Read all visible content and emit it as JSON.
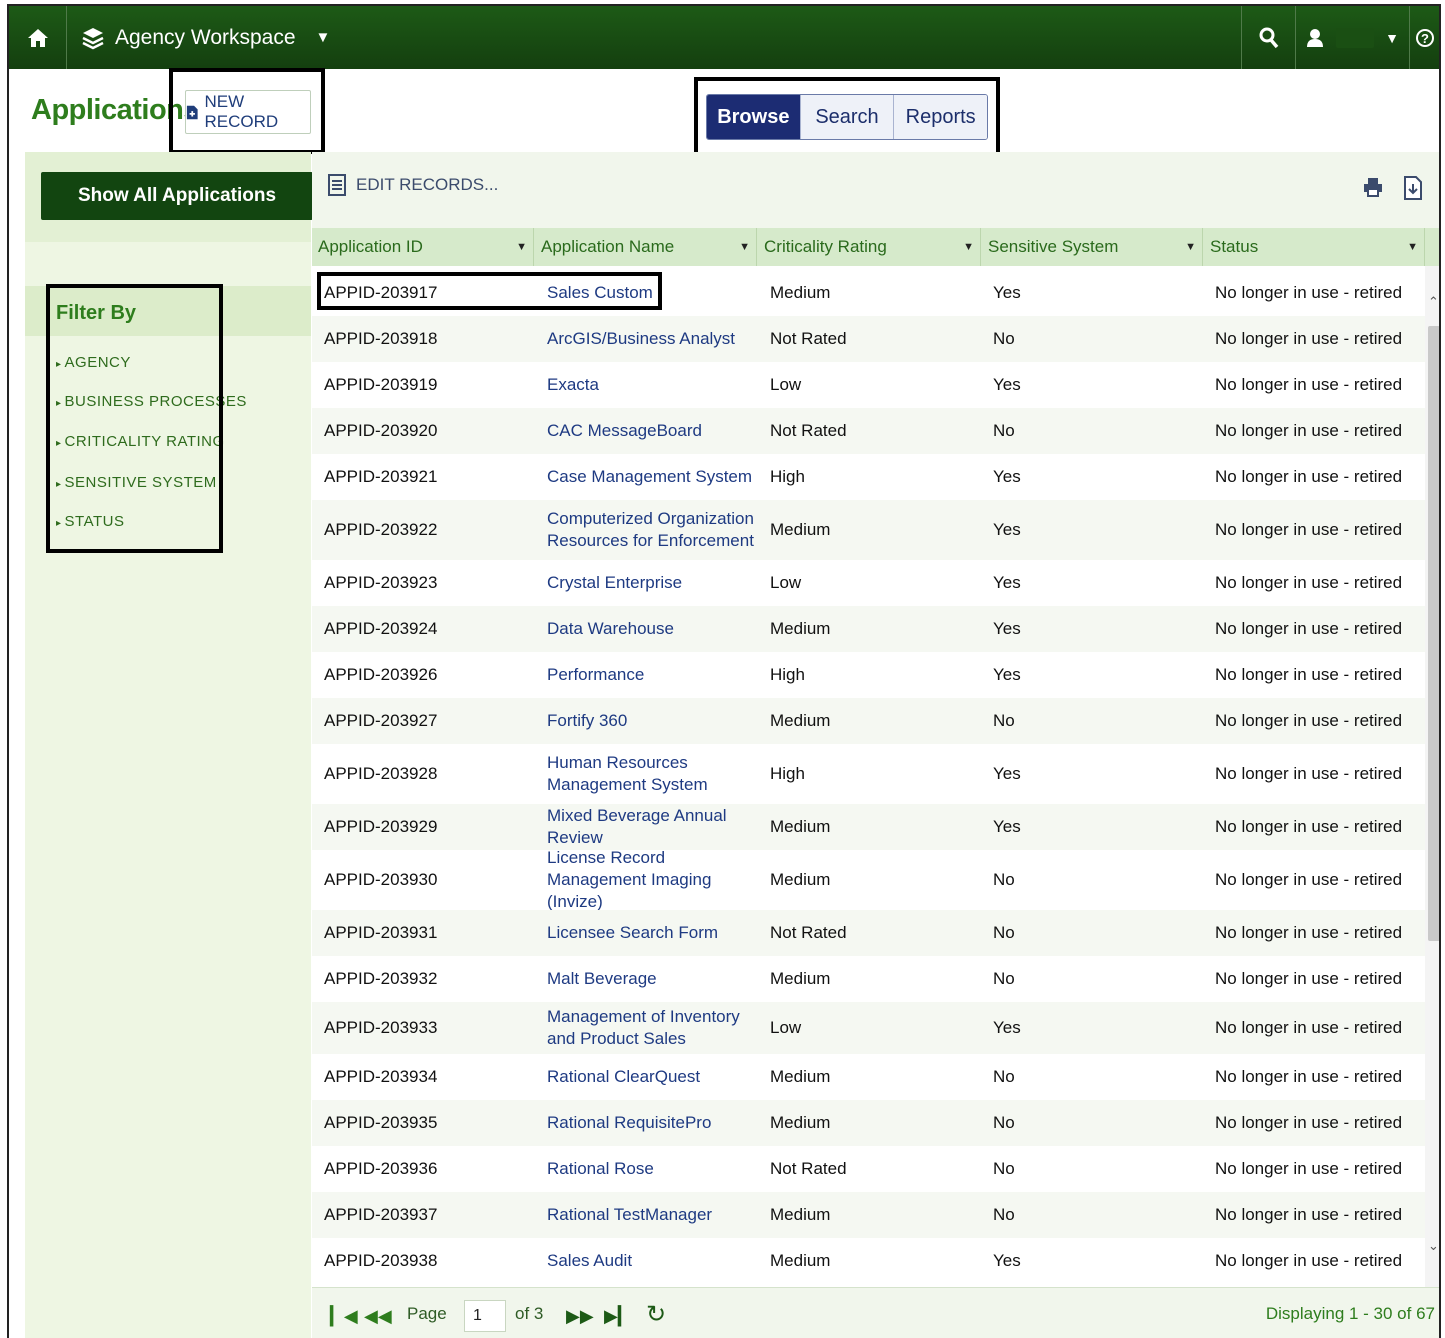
{
  "topbar": {
    "workspace_label": "Agency Workspace",
    "icons": [
      "home-icon",
      "layers-icon",
      "chevron-down-icon",
      "search-icon",
      "user-icon",
      "help-icon"
    ]
  },
  "header": {
    "title": "Applications",
    "new_record_label": "NEW RECORD",
    "tabs": [
      {
        "label": "Browse",
        "active": true
      },
      {
        "label": "Search",
        "active": false
      },
      {
        "label": "Reports",
        "active": false
      }
    ]
  },
  "sidebar": {
    "show_all_label": "Show All Applications",
    "filter_title": "Filter By",
    "filters": [
      "AGENCY",
      "BUSINESS PROCESSES",
      "CRITICALITY RATING",
      "SENSITIVE SYSTEM",
      "STATUS"
    ]
  },
  "toolbar": {
    "edit_records_label": "EDIT RECORDS..."
  },
  "grid": {
    "columns": [
      "Application ID",
      "Application Name",
      "Criticality Rating",
      "Sensitive System",
      "Status"
    ],
    "rows": [
      {
        "id": "APPID-203917",
        "name": "Sales Custom",
        "criticality": "Medium",
        "sensitive": "Yes",
        "status": "No longer in use - retired"
      },
      {
        "id": "APPID-203918",
        "name": "ArcGIS/Business Analyst",
        "criticality": "Not Rated",
        "sensitive": "No",
        "status": "No longer in use - retired"
      },
      {
        "id": "APPID-203919",
        "name": "Exacta",
        "criticality": "Low",
        "sensitive": "Yes",
        "status": "No longer in use - retired"
      },
      {
        "id": "APPID-203920",
        "name": "CAC MessageBoard",
        "criticality": "Not Rated",
        "sensitive": "No",
        "status": "No longer in use - retired"
      },
      {
        "id": "APPID-203921",
        "name": "Case Management System",
        "criticality": "High",
        "sensitive": "Yes",
        "status": "No longer in use - retired"
      },
      {
        "id": "APPID-203922",
        "name": "Computerized Organization Resources for Enforcement",
        "criticality": "Medium",
        "sensitive": "Yes",
        "status": "No longer in use - retired"
      },
      {
        "id": "APPID-203923",
        "name": "Crystal Enterprise",
        "criticality": "Low",
        "sensitive": "Yes",
        "status": "No longer in use - retired"
      },
      {
        "id": "APPID-203924",
        "name": "Data Warehouse",
        "criticality": "Medium",
        "sensitive": "Yes",
        "status": "No longer in use - retired"
      },
      {
        "id": "APPID-203926",
        "name": "Performance",
        "criticality": "High",
        "sensitive": "Yes",
        "status": "No longer in use - retired"
      },
      {
        "id": "APPID-203927",
        "name": "Fortify 360",
        "criticality": "Medium",
        "sensitive": "No",
        "status": "No longer in use - retired"
      },
      {
        "id": "APPID-203928",
        "name": "Human Resources Management System",
        "criticality": "High",
        "sensitive": "Yes",
        "status": "No longer in use - retired"
      },
      {
        "id": "APPID-203929",
        "name": "Mixed Beverage Annual Review",
        "criticality": "Medium",
        "sensitive": "Yes",
        "status": "No longer in use - retired"
      },
      {
        "id": "APPID-203930",
        "name": "License Record Management Imaging (Invize)",
        "criticality": "Medium",
        "sensitive": "No",
        "status": "No longer in use - retired"
      },
      {
        "id": "APPID-203931",
        "name": "Licensee Search Form",
        "criticality": "Not Rated",
        "sensitive": "No",
        "status": "No longer in use - retired"
      },
      {
        "id": "APPID-203932",
        "name": "Malt Beverage",
        "criticality": "Medium",
        "sensitive": "No",
        "status": "No longer in use - retired"
      },
      {
        "id": "APPID-203933",
        "name": "Management of Inventory and Product Sales",
        "criticality": "Low",
        "sensitive": "Yes",
        "status": "No longer in use - retired"
      },
      {
        "id": "APPID-203934",
        "name": "Rational ClearQuest",
        "criticality": "Medium",
        "sensitive": "No",
        "status": "No longer in use - retired"
      },
      {
        "id": "APPID-203935",
        "name": "Rational RequisitePro",
        "criticality": "Medium",
        "sensitive": "No",
        "status": "No longer in use - retired"
      },
      {
        "id": "APPID-203936",
        "name": "Rational Rose",
        "criticality": "Not Rated",
        "sensitive": "No",
        "status": "No longer in use - retired"
      },
      {
        "id": "APPID-203937",
        "name": "Rational TestManager",
        "criticality": "Medium",
        "sensitive": "No",
        "status": "No longer in use - retired"
      },
      {
        "id": "APPID-203938",
        "name": "Sales Audit",
        "criticality": "Medium",
        "sensitive": "Yes",
        "status": "No longer in use - retired"
      }
    ]
  },
  "pager": {
    "page_label": "Page",
    "page_value": "1",
    "of_label": "of 3",
    "displaying": "Displaying 1 - 30 of 67"
  },
  "colors": {
    "topbar": "#1d5a16",
    "accent_green": "#2e7d1d",
    "tab_active": "#1c2c73",
    "link_blue": "#1e3a82"
  }
}
